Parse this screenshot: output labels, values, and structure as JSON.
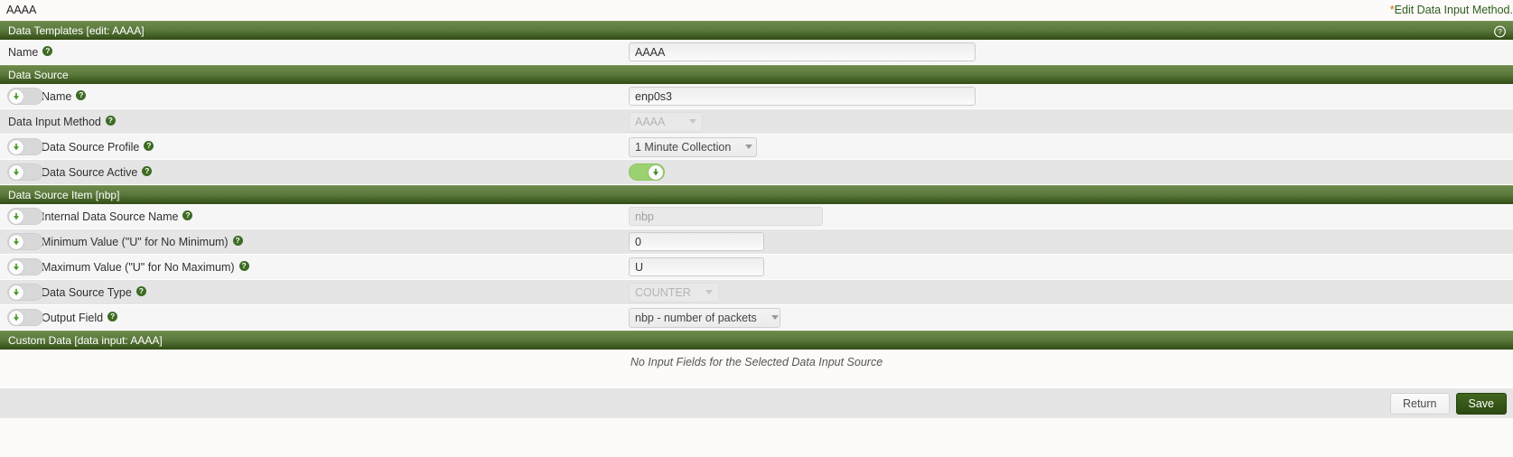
{
  "top": {
    "page_title": "AAAA",
    "edit_link_star": "*",
    "edit_link_text": "Edit Data Input Method."
  },
  "sections": {
    "data_templates": {
      "header": "Data Templates [edit: AAAA]",
      "help_icon": "help-circle-icon"
    },
    "data_source": {
      "header": "Data Source"
    },
    "data_source_item": {
      "header": "Data Source Item [nbp]"
    },
    "custom_data": {
      "header": "Custom Data [data input: AAAA]"
    }
  },
  "fields": {
    "template_name": {
      "label": "Name",
      "value": "AAAA",
      "placeholder": ""
    },
    "ds_name": {
      "label": "Name",
      "value": "enp0s3",
      "placeholder": ""
    },
    "data_input_method": {
      "label": "Data Input Method",
      "value": "AAAA",
      "options": [
        "AAAA"
      ],
      "disabled": true
    },
    "data_source_profile": {
      "label": "Data Source Profile",
      "value": "1 Minute Collection",
      "options": [
        "1 Minute Collection"
      ]
    },
    "data_source_active": {
      "label": "Data Source Active",
      "state": "on"
    },
    "internal_ds_name": {
      "label": "Internal Data Source Name",
      "value": "nbp",
      "disabled": true
    },
    "minimum_value": {
      "label": "Minimum Value (\"U\" for No Minimum)",
      "value": "0"
    },
    "maximum_value": {
      "label": "Maximum Value (\"U\" for No Maximum)",
      "value": "U"
    },
    "data_source_type": {
      "label": "Data Source Type",
      "value": "COUNTER",
      "options": [
        "COUNTER"
      ],
      "disabled": true
    },
    "output_field": {
      "label": "Output Field",
      "value": "nbp - number of packets",
      "options": [
        "nbp - number of packets"
      ]
    }
  },
  "custom_data_note": "No Input Fields for the Selected Data Input Source",
  "buttons": {
    "return_label": "Return",
    "save_label": "Save"
  },
  "icons": {
    "help": "?",
    "toggle_glyph": "arrow-down-icon"
  },
  "colors": {
    "header_green_dark": "#314d14",
    "header_green_light": "#6b8a4a",
    "accent_orange": "#cc6600",
    "link_green": "#2e5c1f",
    "toggle_on_track": "#9bd170",
    "toggle_off_track": "#d8d8d8",
    "save_button": "#2c4a12"
  }
}
